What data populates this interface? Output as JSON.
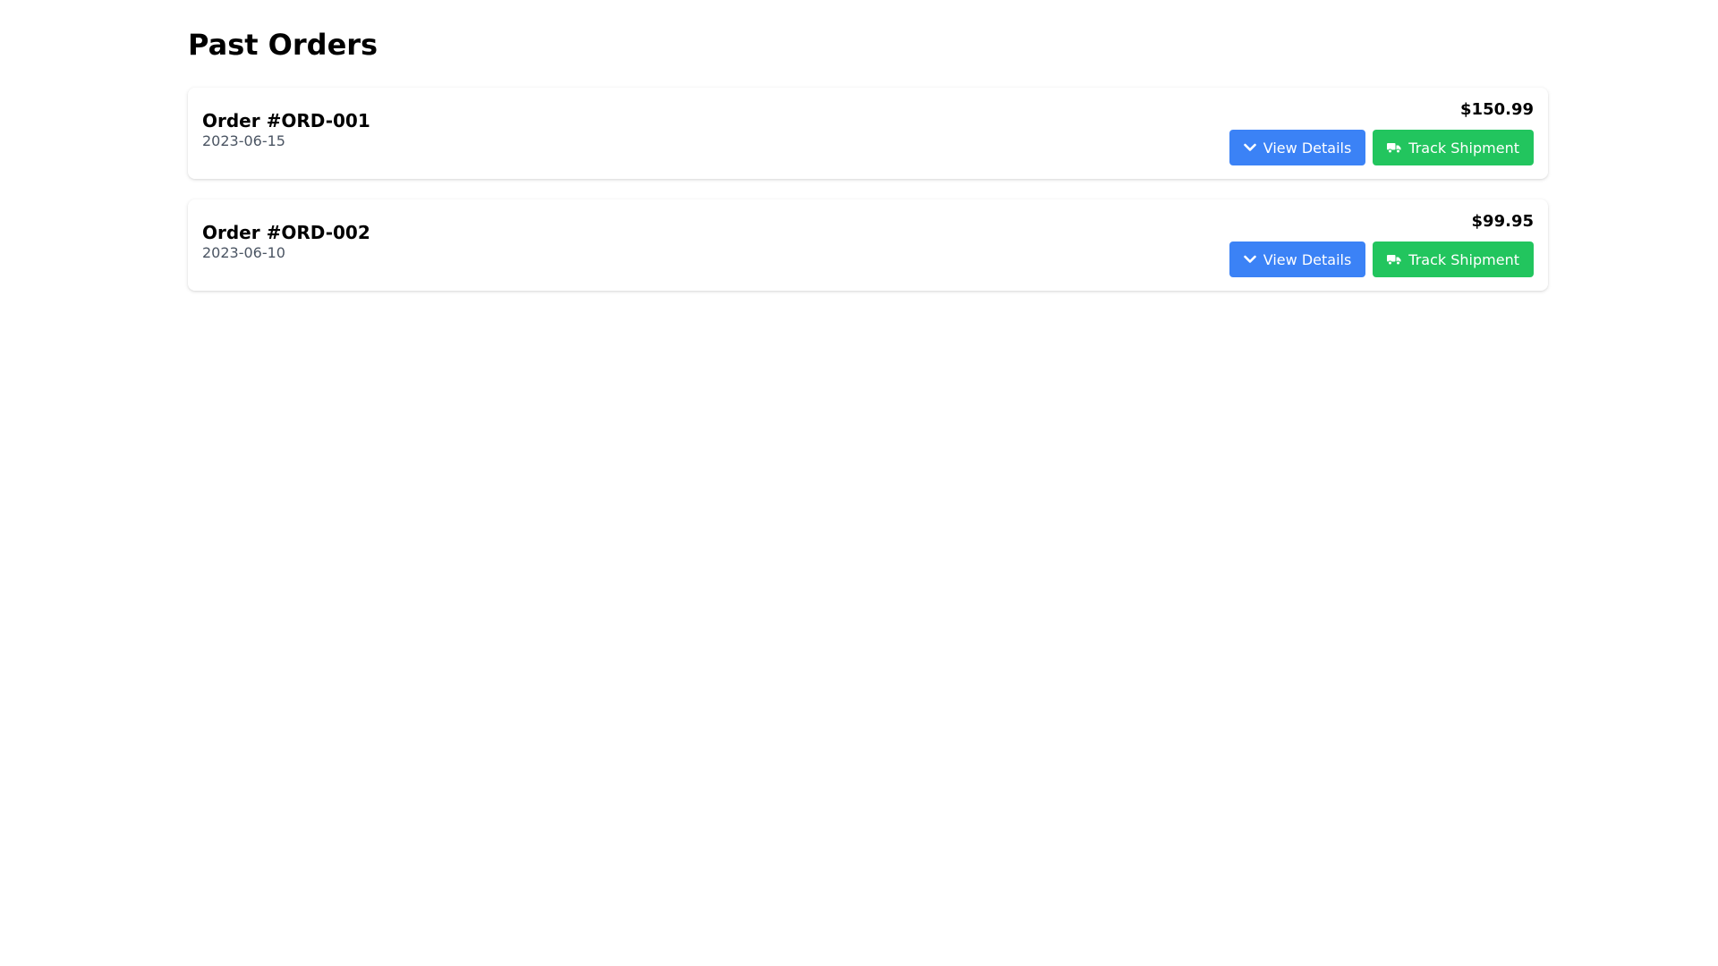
{
  "page": {
    "title": "Past Orders"
  },
  "orders": [
    {
      "number": "Order #ORD-001",
      "date": "2023-06-15",
      "price": "$150.99",
      "view_label": "View Details",
      "track_label": "Track Shipment"
    },
    {
      "number": "Order #ORD-002",
      "date": "2023-06-10",
      "price": "$99.95",
      "view_label": "View Details",
      "track_label": "Track Shipment"
    }
  ],
  "icons": {
    "view": "chevron-down-icon",
    "track": "truck-icon"
  },
  "colors": {
    "view_button": "#3b82f6",
    "track_button": "#22c55e",
    "date_text": "#4b5563"
  }
}
